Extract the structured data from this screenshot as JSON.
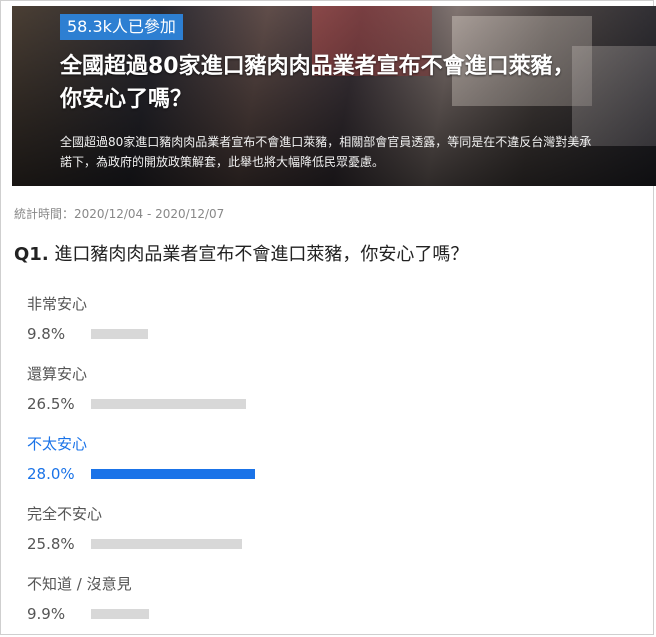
{
  "banner": {
    "badge": "58.3k人已參加",
    "headline_line1": "全國超過80家進口豬肉肉品業者宣布不會進口萊豬，",
    "headline_line2": "你安心了嗎？",
    "description_line1": "全國超過80家進口豬肉肉品業者宣布不會進口萊豬，相關部會官員透露，等同是在不違反台灣對美承",
    "description_line2": "諾下，為政府的開放政策解套，此舉也將大幅降低民眾憂慮。"
  },
  "stats_period": "統計時間：2020/12/04 - 2020/12/07",
  "question": {
    "number": "Q1.",
    "text": "進口豬肉肉品業者宣布不會進口萊豬，你安心了嗎？"
  },
  "options": [
    {
      "label": "非常安心",
      "percent_text": "9.8%",
      "value": 9.8,
      "highlight": false
    },
    {
      "label": "還算安心",
      "percent_text": "26.5%",
      "value": 26.5,
      "highlight": false
    },
    {
      "label": "不太安心",
      "percent_text": "28.0%",
      "value": 28.0,
      "highlight": true
    },
    {
      "label": "完全不安心",
      "percent_text": "25.8%",
      "value": 25.8,
      "highlight": false
    },
    {
      "label": "不知道 / 沒意見",
      "percent_text": "9.9%",
      "value": 9.9,
      "highlight": false
    }
  ],
  "colors": {
    "badge": "#2d7fd2",
    "highlight": "#1a73e8",
    "bar": "#d8d8d8"
  }
}
